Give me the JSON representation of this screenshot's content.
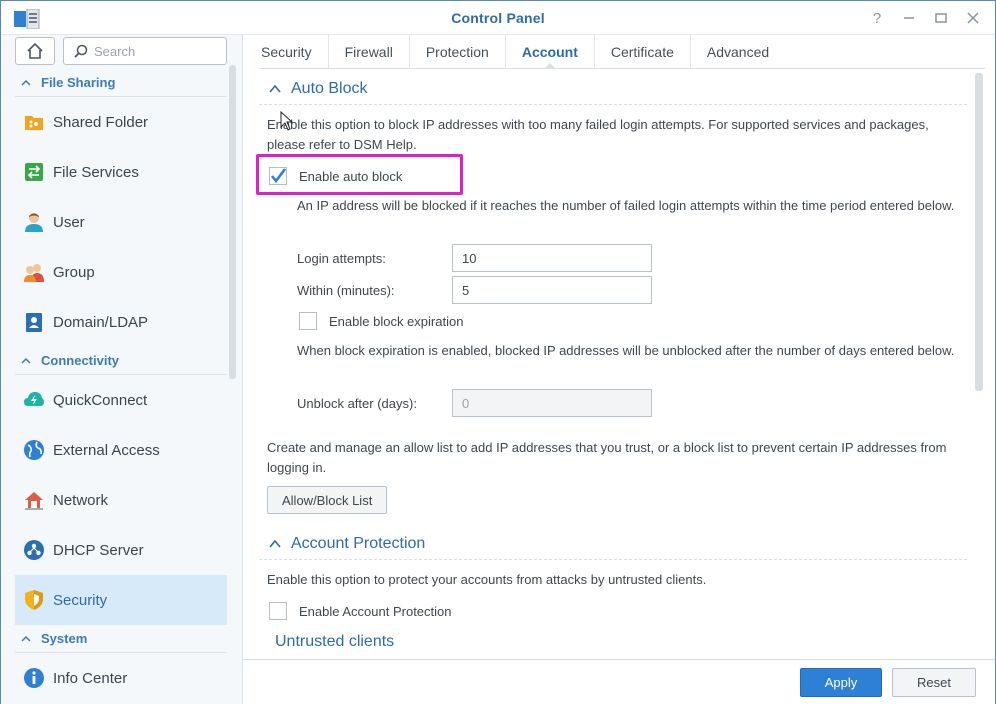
{
  "window": {
    "title": "Control Panel",
    "buttons": [
      "help-icon",
      "minimize-icon",
      "maximize-icon",
      "close-icon"
    ]
  },
  "sidebar": {
    "search_placeholder": "Search",
    "sections": [
      {
        "label": "File Sharing",
        "items": [
          {
            "label": "Shared Folder",
            "icon": "shared-folder-icon"
          },
          {
            "label": "File Services",
            "icon": "file-services-icon"
          },
          {
            "label": "User",
            "icon": "user-icon"
          },
          {
            "label": "Group",
            "icon": "group-icon"
          },
          {
            "label": "Domain/LDAP",
            "icon": "domain-ldap-icon"
          }
        ]
      },
      {
        "label": "Connectivity",
        "items": [
          {
            "label": "QuickConnect",
            "icon": "quickconnect-icon"
          },
          {
            "label": "External Access",
            "icon": "external-access-icon"
          },
          {
            "label": "Network",
            "icon": "network-icon"
          },
          {
            "label": "DHCP Server",
            "icon": "dhcp-server-icon"
          },
          {
            "label": "Security",
            "icon": "security-icon",
            "active": true
          }
        ]
      },
      {
        "label": "System",
        "items": [
          {
            "label": "Info Center",
            "icon": "info-center-icon"
          }
        ]
      }
    ]
  },
  "tabs": [
    {
      "label": "Security"
    },
    {
      "label": "Firewall"
    },
    {
      "label": "Protection"
    },
    {
      "label": "Account",
      "active": true
    },
    {
      "label": "Certificate"
    },
    {
      "label": "Advanced"
    }
  ],
  "auto_block": {
    "heading": "Auto Block",
    "description": "Enable this option to block IP addresses with too many failed login attempts. For supported services and packages, please refer to DSM Help.",
    "enable_label": "Enable auto block",
    "enable_checked": true,
    "block_note": "An IP address will be blocked if it reaches the number of failed login attempts within the time period entered below.",
    "login_attempts_label": "Login attempts:",
    "login_attempts_value": "10",
    "within_label": "Within (minutes):",
    "within_value": "5",
    "expiration_label": "Enable block expiration",
    "expiration_checked": false,
    "expiration_note": "When block expiration is enabled, blocked IP addresses will be unblocked after the number of days entered below.",
    "unblock_label": "Unblock after (days):",
    "unblock_value": "0",
    "list_note": "Create and manage an allow list to add IP addresses that you trust, or a block list to prevent certain IP addresses from logging in.",
    "list_button": "Allow/Block List"
  },
  "account_protection": {
    "heading": "Account Protection",
    "description": "Enable this option to protect your accounts from attacks by untrusted clients.",
    "enable_label": "Enable Account Protection",
    "enable_checked": false,
    "untrusted_heading": "Untrusted clients"
  },
  "footer": {
    "apply_label": "Apply",
    "reset_label": "Reset"
  },
  "colors": {
    "accent": "#2d6ca8",
    "apply": "#2e7fd6",
    "highlight": "#e020c8"
  }
}
